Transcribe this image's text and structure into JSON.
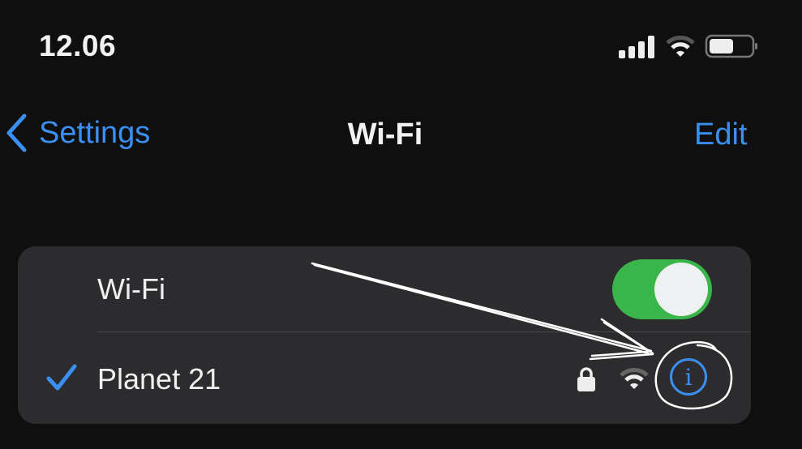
{
  "status_bar": {
    "time": "12.06",
    "battery_level": 0.55,
    "cell_bars": 4,
    "wifi_bars": 2
  },
  "nav": {
    "back_label": "Settings",
    "title": "Wi-Fi",
    "edit_label": "Edit"
  },
  "wifi_row": {
    "label": "Wi-Fi",
    "enabled": true
  },
  "network_row": {
    "name": "Planet 21",
    "connected": true,
    "secured": true,
    "info_glyph": "i"
  },
  "colors": {
    "accent": "#3a8ff0",
    "toggle_on": "#3ab54a",
    "card": "#2c2c2e",
    "background": "#0f0f10"
  }
}
